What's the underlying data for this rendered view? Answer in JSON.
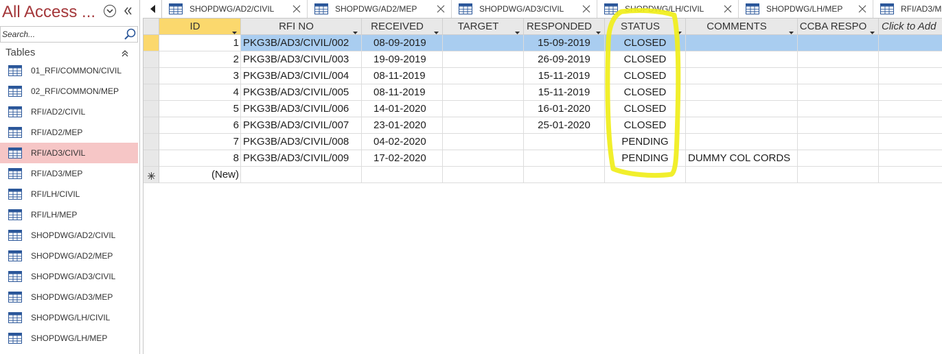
{
  "nav": {
    "title": "All Access ...",
    "search_placeholder": "Search...",
    "group_label": "Tables",
    "items": [
      {
        "label": "01_RFI/COMMON/CIVIL",
        "selected": false
      },
      {
        "label": "02_RFI/COMMON/MEP",
        "selected": false
      },
      {
        "label": "RFI/AD2/CIVIL",
        "selected": false
      },
      {
        "label": "RFI/AD2/MEP",
        "selected": false
      },
      {
        "label": "RFI/AD3/CIVIL",
        "selected": true
      },
      {
        "label": "RFI/AD3/MEP",
        "selected": false
      },
      {
        "label": "RFI/LH/CIVIL",
        "selected": false
      },
      {
        "label": "RFI/LH/MEP",
        "selected": false
      },
      {
        "label": "SHOPDWG/AD2/CIVIL",
        "selected": false
      },
      {
        "label": "SHOPDWG/AD2/MEP",
        "selected": false
      },
      {
        "label": "SHOPDWG/AD3/CIVIL",
        "selected": false
      },
      {
        "label": "SHOPDWG/AD3/MEP",
        "selected": false
      },
      {
        "label": "SHOPDWG/LH/CIVIL",
        "selected": false
      },
      {
        "label": "SHOPDWG/LH/MEP",
        "selected": false
      }
    ]
  },
  "tabs": [
    {
      "label": "SHOPDWG/AD2/CIVIL"
    },
    {
      "label": "SHOPDWG/AD2/MEP"
    },
    {
      "label": "SHOPDWG/AD3/CIVIL"
    },
    {
      "label": "SHOPDWG/LH/CIVIL"
    },
    {
      "label": "SHOPDWG/LH/MEP"
    },
    {
      "label": "RFI/AD3/M"
    }
  ],
  "columns": [
    {
      "label": "ID"
    },
    {
      "label": "RFI NO"
    },
    {
      "label": "RECEIVED"
    },
    {
      "label": "TARGET"
    },
    {
      "label": "RESPONDED"
    },
    {
      "label": "STATUS"
    },
    {
      "label": "COMMENTS"
    },
    {
      "label": "CCBA RESPO"
    },
    {
      "label": "Click to Add"
    }
  ],
  "rows": [
    {
      "id": "1",
      "rfi_no": "PKG3B/AD3/CIVIL/002",
      "received": "08-09-2019",
      "target": "",
      "responded": "15-09-2019",
      "status": "CLOSED",
      "comments": "",
      "ccba": ""
    },
    {
      "id": "2",
      "rfi_no": "PKG3B/AD3/CIVIL/003",
      "received": "19-09-2019",
      "target": "",
      "responded": "26-09-2019",
      "status": "CLOSED",
      "comments": "",
      "ccba": ""
    },
    {
      "id": "3",
      "rfi_no": "PKG3B/AD3/CIVIL/004",
      "received": "08-11-2019",
      "target": "",
      "responded": "15-11-2019",
      "status": "CLOSED",
      "comments": "",
      "ccba": ""
    },
    {
      "id": "4",
      "rfi_no": "PKG3B/AD3/CIVIL/005",
      "received": "08-11-2019",
      "target": "",
      "responded": "15-11-2019",
      "status": "CLOSED",
      "comments": "",
      "ccba": ""
    },
    {
      "id": "5",
      "rfi_no": "PKG3B/AD3/CIVIL/006",
      "received": "14-01-2020",
      "target": "",
      "responded": "16-01-2020",
      "status": "CLOSED",
      "comments": "",
      "ccba": ""
    },
    {
      "id": "6",
      "rfi_no": "PKG3B/AD3/CIVIL/007",
      "received": "23-01-2020",
      "target": "",
      "responded": "25-01-2020",
      "status": "CLOSED",
      "comments": "",
      "ccba": ""
    },
    {
      "id": "7",
      "rfi_no": "PKG3B/AD3/CIVIL/008",
      "received": "04-02-2020",
      "target": "",
      "responded": "",
      "status": "PENDING",
      "comments": "",
      "ccba": ""
    },
    {
      "id": "8",
      "rfi_no": "PKG3B/AD3/CIVIL/009",
      "received": "17-02-2020",
      "target": "",
      "responded": "",
      "status": "PENDING",
      "comments": "DUMMY COL CORDS",
      "ccba": ""
    }
  ],
  "new_row_label": "(New)",
  "icons": {
    "nav_menu": "chevron-circle-down-icon",
    "collapse": "double-chevron-left-icon",
    "search": "search-icon",
    "group": "double-chevron-up-icon",
    "table": "table-icon",
    "tab_close": "close-icon",
    "tab_scroll": "triangle-left-icon",
    "sort": "dropdown-arrow-icon",
    "new_record": "asterisk-icon"
  },
  "colors": {
    "title": "#a4373a",
    "nav_selected": "#f6c6c6",
    "row_selected": "#a9cdf0",
    "header_selected": "#fbd86d",
    "highlight_marker": "#f0ee1a"
  }
}
